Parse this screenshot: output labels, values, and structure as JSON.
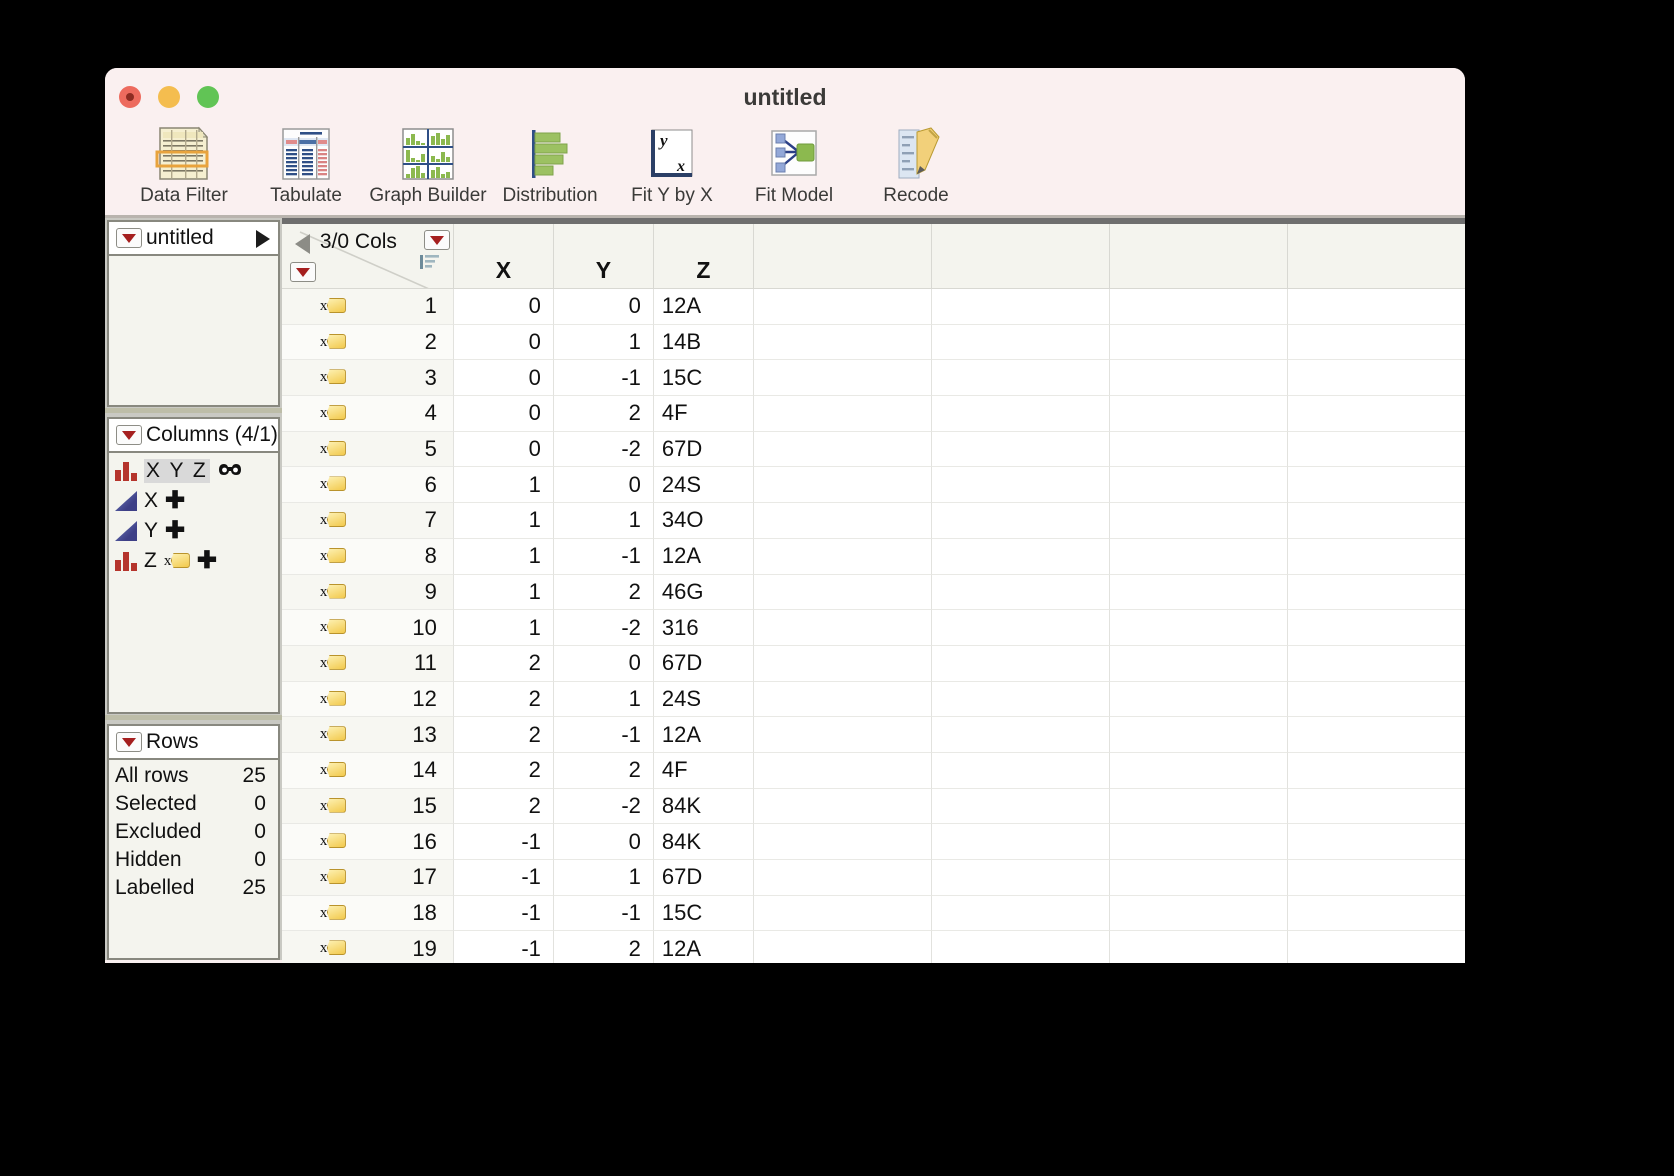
{
  "window": {
    "title": "untitled",
    "traffic_lights": [
      "close-button",
      "minimize-button",
      "maximize-button"
    ]
  },
  "toolbar": {
    "items": [
      {
        "label": "Data Filter",
        "icon": "data-filter-icon"
      },
      {
        "label": "Tabulate",
        "icon": "tabulate-icon"
      },
      {
        "label": "Graph Builder",
        "icon": "graph-builder-icon"
      },
      {
        "label": "Distribution",
        "icon": "distribution-icon"
      },
      {
        "label": "Fit Y by X",
        "icon": "fit-y-by-x-icon"
      },
      {
        "label": "Fit Model",
        "icon": "fit-model-icon"
      },
      {
        "label": "Recode",
        "icon": "recode-icon"
      }
    ]
  },
  "sidebar": {
    "table_panel": {
      "title": "untitled"
    },
    "columns_panel": {
      "title": "Columns (4/1)",
      "items": [
        {
          "name": "X Y Z",
          "modeling_type": "nominal",
          "selected": true,
          "has_group_icon": true,
          "has_plus": false
        },
        {
          "name": "X",
          "modeling_type": "continuous",
          "selected": false,
          "has_plus": true
        },
        {
          "name": "Y",
          "modeling_type": "continuous",
          "selected": false,
          "has_plus": true
        },
        {
          "name": "Z",
          "modeling_type": "nominal",
          "selected": false,
          "has_label_icon": true,
          "has_plus": true
        }
      ]
    },
    "rows_panel": {
      "title": "Rows",
      "stats": [
        {
          "label": "All rows",
          "value": "25"
        },
        {
          "label": "Selected",
          "value": "0"
        },
        {
          "label": "Excluded",
          "value": "0"
        },
        {
          "label": "Hidden",
          "value": "0"
        },
        {
          "label": "Labelled",
          "value": "25"
        }
      ]
    }
  },
  "table": {
    "cols_indicator": "3/0 Cols",
    "headers": [
      "X",
      "Y",
      "Z"
    ],
    "empty_header_count": 4,
    "rows": [
      {
        "n": "1",
        "X": "0",
        "Y": "0",
        "Z": "12A"
      },
      {
        "n": "2",
        "X": "0",
        "Y": "1",
        "Z": "14B"
      },
      {
        "n": "3",
        "X": "0",
        "Y": "-1",
        "Z": "15C"
      },
      {
        "n": "4",
        "X": "0",
        "Y": "2",
        "Z": "4F"
      },
      {
        "n": "5",
        "X": "0",
        "Y": "-2",
        "Z": "67D"
      },
      {
        "n": "6",
        "X": "1",
        "Y": "0",
        "Z": "24S"
      },
      {
        "n": "7",
        "X": "1",
        "Y": "1",
        "Z": "34O"
      },
      {
        "n": "8",
        "X": "1",
        "Y": "-1",
        "Z": "12A"
      },
      {
        "n": "9",
        "X": "1",
        "Y": "2",
        "Z": "46G"
      },
      {
        "n": "10",
        "X": "1",
        "Y": "-2",
        "Z": "316"
      },
      {
        "n": "11",
        "X": "2",
        "Y": "0",
        "Z": "67D"
      },
      {
        "n": "12",
        "X": "2",
        "Y": "1",
        "Z": "24S"
      },
      {
        "n": "13",
        "X": "2",
        "Y": "-1",
        "Z": "12A"
      },
      {
        "n": "14",
        "X": "2",
        "Y": "2",
        "Z": "4F"
      },
      {
        "n": "15",
        "X": "2",
        "Y": "-2",
        "Z": "84K"
      },
      {
        "n": "16",
        "X": "-1",
        "Y": "0",
        "Z": "84K"
      },
      {
        "n": "17",
        "X": "-1",
        "Y": "1",
        "Z": "67D"
      },
      {
        "n": "18",
        "X": "-1",
        "Y": "-1",
        "Z": "15C"
      },
      {
        "n": "19",
        "X": "-1",
        "Y": "2",
        "Z": "12A"
      }
    ]
  },
  "colors": {
    "titlebar": "#faf0f0",
    "nominal_icon": "#b5342c",
    "continuous_icon": "#3d3f86",
    "dropdown_triangle": "#a51f1f",
    "label_icon": "#f2c94c"
  }
}
